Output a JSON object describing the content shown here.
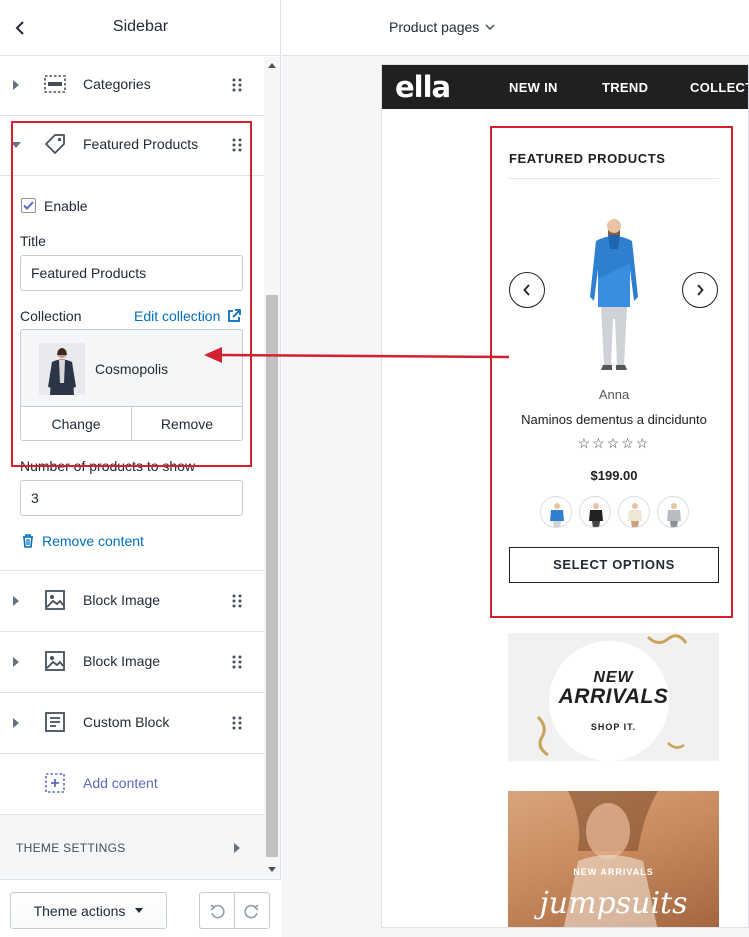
{
  "panel": {
    "title": "Sidebar",
    "sections": [
      {
        "label": "Categories"
      },
      {
        "label": "Featured Products"
      },
      {
        "label": "Block Image"
      },
      {
        "label": "Block Image"
      },
      {
        "label": "Custom Block"
      }
    ],
    "featured": {
      "enable_label": "Enable",
      "enable_checked": true,
      "title_label": "Title",
      "title_value": "Featured Products",
      "collection_label": "Collection",
      "edit_collection": "Edit collection",
      "collection_name": "Cosmopolis",
      "change_label": "Change",
      "remove_label": "Remove",
      "num_label": "Number of products to show",
      "num_value": "3",
      "remove_content": "Remove content"
    },
    "add_content": "Add content",
    "theme_settings": "THEME SETTINGS",
    "theme_actions": "Theme actions"
  },
  "preview": {
    "page_select": "Product pages",
    "logo": "ella",
    "nav": [
      "NEW IN",
      "TREND",
      "COLLECT"
    ],
    "featured_title": "FEATURED PRODUCTS",
    "product": {
      "vendor": "Anna",
      "name": "Naminos dementus a dincidunto",
      "stars": "☆☆☆☆☆",
      "rating": 0,
      "price": "$199.00"
    },
    "select_options": "SELECT OPTIONS",
    "banner1": {
      "line1": "NEW",
      "line2": "ARRIVALS",
      "line3": "SHOP IT."
    },
    "banner2": {
      "line1": "NEW ARRIVALS",
      "line2": "jumpsuits"
    }
  },
  "colors": {
    "highlight": "#d3212f",
    "link": "#006fbb",
    "add_link": "#5c6ac4",
    "nav_bg": "#202020",
    "product_blue": "#2f7fd0"
  }
}
